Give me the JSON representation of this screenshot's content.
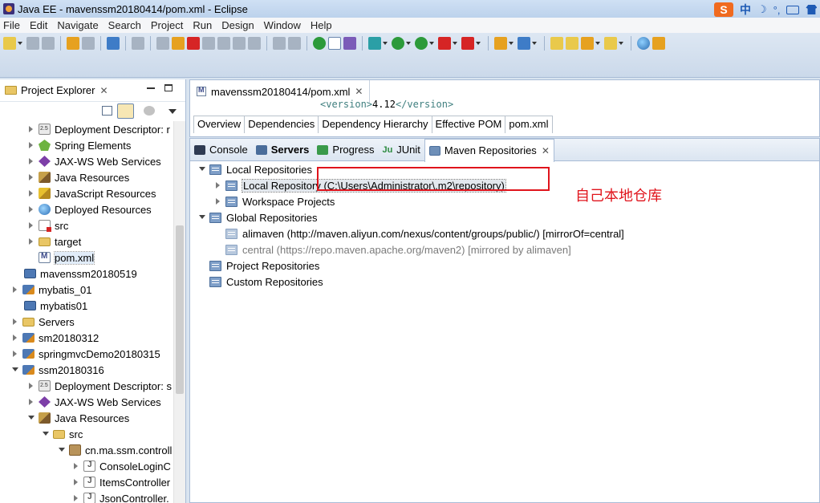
{
  "window": {
    "title": "Java EE - mavenssm20180414/pom.xml - Eclipse"
  },
  "ime": {
    "logo": "S",
    "lang": "中",
    "moon": "☽",
    "dots": "°,"
  },
  "menu": [
    "File",
    "Edit",
    "Navigate",
    "Search",
    "Project",
    "Run",
    "Design",
    "Window",
    "Help"
  ],
  "colors": {
    "accent": "#3e7cc7",
    "annotation": "#e0141c"
  },
  "project_explorer": {
    "tab_label": "Project Explorer",
    "close": "✕",
    "items": [
      {
        "label": "Deployment Descriptor: r",
        "icon": "deployment-descriptor-icon"
      },
      {
        "label": "Spring Elements",
        "icon": "spring-icon"
      },
      {
        "label": "JAX-WS Web Services",
        "icon": "jaxws-icon"
      },
      {
        "label": "Java Resources",
        "icon": "java-resources-icon"
      },
      {
        "label": "JavaScript Resources",
        "icon": "javascript-resources-icon"
      },
      {
        "label": "Deployed Resources",
        "icon": "deployed-resources-icon"
      },
      {
        "label": "src",
        "icon": "source-folder-icon"
      },
      {
        "label": "target",
        "icon": "folder-icon"
      },
      {
        "label": "pom.xml",
        "icon": "maven-file-icon"
      },
      {
        "label": "mavenssm20180519",
        "icon": "project-icon"
      },
      {
        "label": "mybatis_01",
        "icon": "maven-project-icon"
      },
      {
        "label": "mybatis01",
        "icon": "project-icon"
      },
      {
        "label": "Servers",
        "icon": "folder-icon"
      },
      {
        "label": "sm20180312",
        "icon": "maven-project-icon"
      },
      {
        "label": "springmvcDemo20180315",
        "icon": "maven-project-icon"
      },
      {
        "label": "ssm20180316",
        "icon": "maven-project-icon"
      },
      {
        "label": "Deployment Descriptor: s",
        "icon": "deployment-descriptor-icon"
      },
      {
        "label": "JAX-WS Web Services",
        "icon": "jaxws-icon"
      },
      {
        "label": "Java Resources",
        "icon": "java-resources-icon"
      },
      {
        "label": "src",
        "icon": "source-folder-icon"
      },
      {
        "label": "cn.ma.ssm.controll",
        "icon": "package-icon"
      },
      {
        "label": "ConsoleLoginC",
        "icon": "java-file-icon"
      },
      {
        "label": "ItemsController",
        "icon": "java-file-icon"
      },
      {
        "label": "JsonController.",
        "icon": "java-file-icon"
      }
    ]
  },
  "editor": {
    "tab_label": "mavenssm20180414/pom.xml",
    "code_line": {
      "open": "<version>",
      "text": "4.12",
      "close": "</version>"
    },
    "pom_tabs": [
      "Overview",
      "Dependencies",
      "Dependency Hierarchy",
      "Effective POM",
      "pom.xml"
    ]
  },
  "bottom": {
    "tabs": [
      {
        "label": "Console",
        "icon": "console-icon"
      },
      {
        "label": "Servers",
        "icon": "servers-icon"
      },
      {
        "label": "Progress",
        "icon": "progress-icon"
      },
      {
        "label": "JUnit",
        "icon": "junit-icon",
        "prefix": "Ju"
      },
      {
        "label": "Maven Repositories",
        "icon": "maven-repositories-icon"
      }
    ],
    "repos": {
      "local": "Local Repositories",
      "local_repo_name": "Local Repository",
      "local_repo_path": "(C:\\Users\\Administrator\\.m2\\repository)",
      "workspace": "Workspace Projects",
      "global": "Global Repositories",
      "alimaven": "alimaven (http://maven.aliyun.com/nexus/content/groups/public/) [mirrorOf=central]",
      "central": "central (https://repo.maven.apache.org/maven2) [mirrored by alimaven]",
      "project": "Project Repositories",
      "custom": "Custom Repositories"
    }
  },
  "annotation": {
    "text": "自己本地仓库"
  }
}
